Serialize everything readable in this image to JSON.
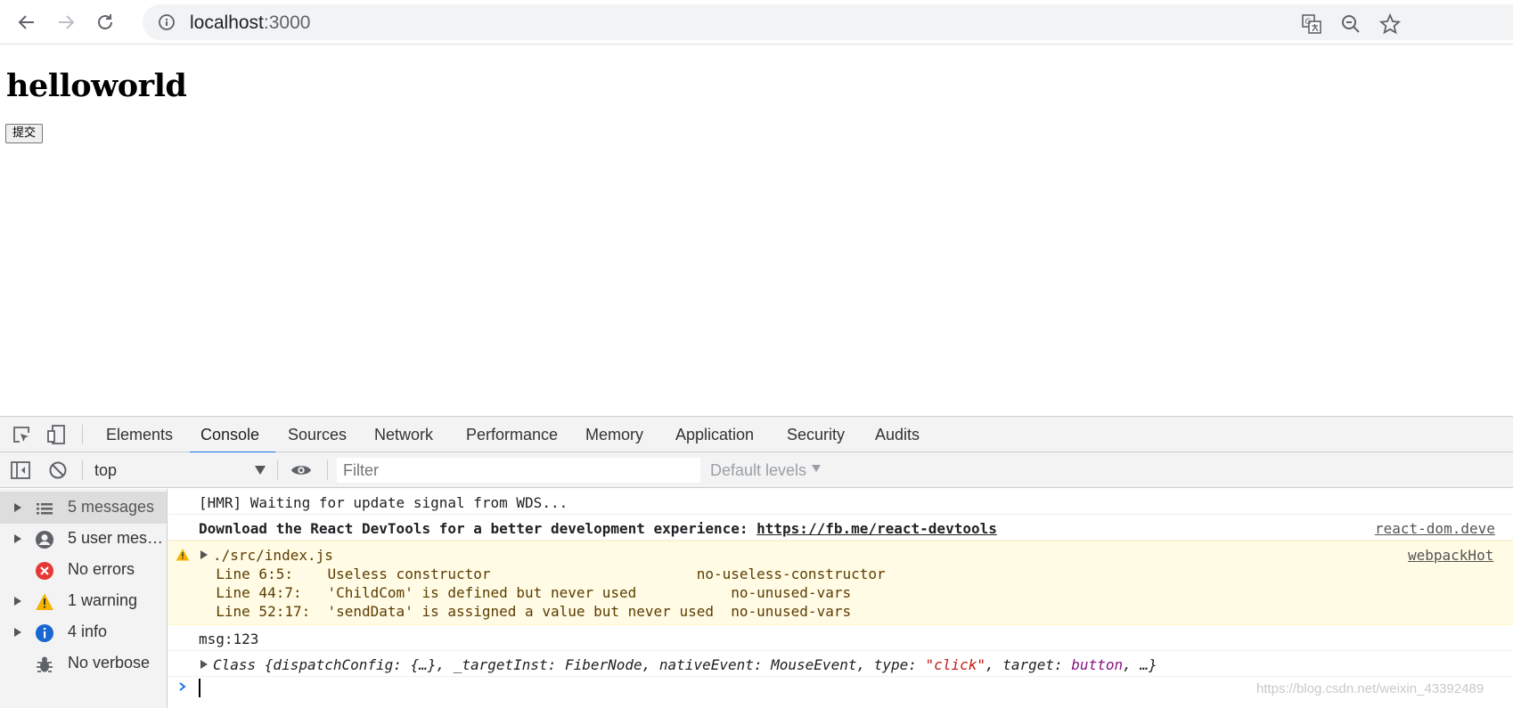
{
  "browser": {
    "url_host": "localhost",
    "url_port": ":3000"
  },
  "page": {
    "title": "helloworld",
    "submit_label": "提交"
  },
  "devtools": {
    "tabs": [
      "Elements",
      "Console",
      "Sources",
      "Network",
      "Performance",
      "Memory",
      "Application",
      "Security",
      "Audits"
    ],
    "active_tab": "Console",
    "context": "top",
    "filter_placeholder": "Filter",
    "levels_label": "Default levels",
    "sidebar": [
      {
        "label": "5 messages",
        "icon": "list-icon",
        "expandable": true,
        "selected": true
      },
      {
        "label": "5 user mess...",
        "icon": "user-icon",
        "expandable": true,
        "selected": false
      },
      {
        "label": "No errors",
        "icon": "error-icon",
        "expandable": false,
        "selected": false
      },
      {
        "label": "1 warning",
        "icon": "warning-icon",
        "expandable": true,
        "selected": false
      },
      {
        "label": "4 info",
        "icon": "info-icon",
        "expandable": true,
        "selected": false
      },
      {
        "label": "No verbose",
        "icon": "bug-icon",
        "expandable": false,
        "selected": false
      }
    ],
    "messages": {
      "hmr": "[HMR] Waiting for update signal from WDS...",
      "react_devtools_text": "Download the React DevTools for a better development experience: ",
      "react_devtools_link": "https://fb.me/react-devtools",
      "react_devtools_source": "react-dom.deve",
      "warning_file": "./src/index.js",
      "warning_source": "webpackHot",
      "warning_lines": [
        "  Line 6:5:    Useless constructor                        no-useless-constructor",
        "  Line 44:7:   'ChildCom' is defined but never used           no-unused-vars",
        "  Line 52:17:  'sendData' is assigned a value but never used  no-unused-vars"
      ],
      "msg": "msg:123",
      "class_obj": {
        "prefix": "Class {dispatchConfig: {…}, _targetInst: FiberNode, nativeEvent: MouseEvent, type: ",
        "type_value": "\"click\"",
        "mid": ", target: ",
        "target_value": "button",
        "suffix": ", …}"
      }
    },
    "watermark": "https://blog.csdn.net/weixin_43392489"
  },
  "colors": {
    "accent": "#1a73e8",
    "warning_bg": "#fffbe5",
    "error": "#e53935",
    "warning": "#f4b400",
    "info": "#1967d2"
  }
}
